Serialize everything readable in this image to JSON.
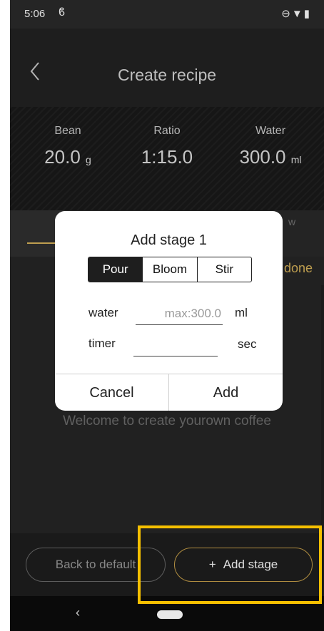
{
  "status_bar": {
    "time": "5:06",
    "icons": [
      "dnd-icon",
      "wifi-icon",
      "battery-icon"
    ]
  },
  "header": {
    "title": "Create recipe"
  },
  "stats": {
    "bean": {
      "label": "Bean",
      "value": "20.0",
      "unit": "g"
    },
    "ratio": {
      "label": "Ratio",
      "value": "1:15.0"
    },
    "water": {
      "label": "Water",
      "value": "300.0",
      "unit": "ml"
    }
  },
  "tabs": {
    "partial_right": "w"
  },
  "list": {
    "done_label": "done",
    "empty_text": "Welcome to create yourown coffee"
  },
  "dialog": {
    "title": "Add stage 1",
    "segments": [
      "Pour",
      "Bloom",
      "Stir"
    ],
    "selected_segment": "Pour",
    "water_label": "water",
    "water_placeholder": "max:300.0",
    "water_unit": "ml",
    "timer_label": "timer",
    "timer_value": "",
    "timer_unit": "sec",
    "cancel_label": "Cancel",
    "add_label": "Add"
  },
  "bottom": {
    "default_label": "Back to default",
    "add_stage_label": "Add stage",
    "add_stage_icon": "+"
  },
  "colors": {
    "accent": "#d9b45a",
    "highlight": "#f5c000",
    "background": "#262626"
  }
}
